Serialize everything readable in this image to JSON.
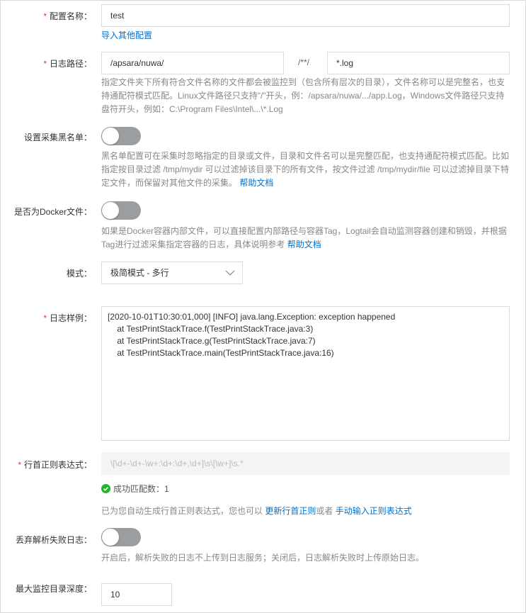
{
  "config_name": {
    "label": "配置名称：",
    "value": "test",
    "import_link": "导入其他配置"
  },
  "log_path": {
    "label": "日志路径：",
    "dir": "/apsara/nuwa/",
    "separator": "/**/",
    "file": "*.log",
    "help": [
      "指定文件夹下所有符合文件名称的文件都会被监控到（包含所有层次的目录），文件名称可以是完整名，也支",
      "持通配符模式匹配。Linux文件路径只支持\"/\"开头，例：/apsara/nuwa/.../app.Log，Windows文件路径只支持",
      "盘符开头，例如：C:\\Program Files\\Intel\\...\\*.Log"
    ]
  },
  "blacklist": {
    "label": "设置采集黑名单：",
    "enabled": false,
    "help": [
      "黑名单配置可在采集时忽略指定的目录或文件，目录和文件名可以是完整匹配，也支持通配符模式匹配。比如",
      "指定按目录过滤 /tmp/mydir 可以过滤掉该目录下的所有文件，按文件过滤 /tmp/mydir/file 可以过滤掉目录下特",
      "定文件，而保留对其他文件的采集。 "
    ],
    "help_link": "帮助文档"
  },
  "docker": {
    "label": "是否为Docker文件：",
    "enabled": false,
    "help": [
      "如果是Docker容器内部文件，可以直接配置内部路径与容器Tag，Logtail会自动监测容器创建和销毁，并根据",
      "Tag进行过滤采集指定容器的日志，具体说明参考 "
    ],
    "help_link": "帮助文档"
  },
  "mode": {
    "label": "模式：",
    "value": "极简模式 - 多行"
  },
  "sample": {
    "label": "日志样例：",
    "value": "[2020-10-01T10:30:01,000] [INFO] java.lang.Exception: exception happened\n    at TestPrintStackTrace.f(TestPrintStackTrace.java:3)\n    at TestPrintStackTrace.g(TestPrintStackTrace.java:7)\n    at TestPrintStackTrace.main(TestPrintStackTrace.java:16)"
  },
  "regex": {
    "label": "行首正则表达式：",
    "value": "\\[\\d+-\\d+-\\w+:\\d+:\\d+,\\d+]\\s\\[\\w+]\\s.*",
    "match": "成功匹配数：1",
    "auto_text": "已为您自动生成行首正则表达式，您也可以 ",
    "update_link": "更新行首正则",
    "or_text": "或者 ",
    "manual_link": "手动输入正则表达式"
  },
  "discard": {
    "label": "丢弃解析失败日志：",
    "enabled": false,
    "help": "开启后，解析失败的日志不上传到日志服务；关闭后，日志解析失败时上传原始日志。"
  },
  "depth": {
    "label": "最大监控目录深度：",
    "value": "10"
  },
  "colors": {
    "link": "#0070cc",
    "required": "#e4393c",
    "success": "#1fb52b"
  }
}
